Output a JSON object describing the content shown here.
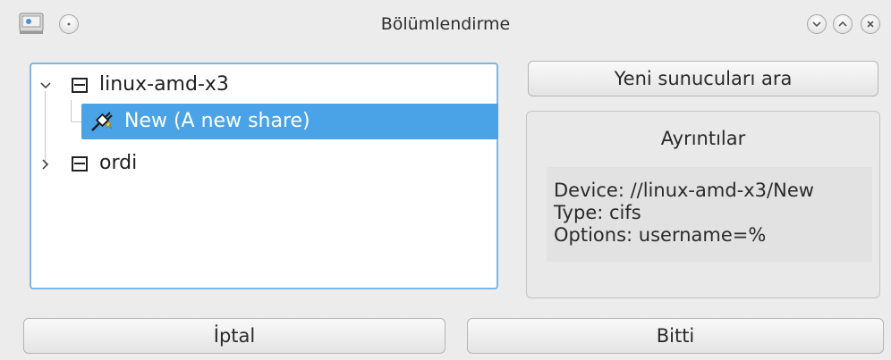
{
  "window": {
    "title": "Bölümlendirme",
    "app_icon": "drive-icon",
    "controls": [
      "menu-icon",
      "minimize-icon",
      "maximize-icon",
      "close-icon"
    ]
  },
  "tree": {
    "items": [
      {
        "label": "linux-amd-x3",
        "icon": "computer-icon",
        "expanded": true
      },
      {
        "label": "New (A new share)",
        "icon": "share-icon",
        "selected": true
      },
      {
        "label": "ordi",
        "icon": "computer-icon",
        "expanded": false
      }
    ]
  },
  "actions": {
    "search_label": "Yeni sunucuları ara",
    "cancel_label": "İptal",
    "done_label": "Bitti"
  },
  "details": {
    "title": "Ayrıntılar",
    "lines": [
      "Device: //linux-amd-x3/New",
      "Type: cifs",
      "Options: username=%"
    ]
  },
  "colors": {
    "selection": "#4aa3e6",
    "focus_border": "#7eb6e8"
  }
}
